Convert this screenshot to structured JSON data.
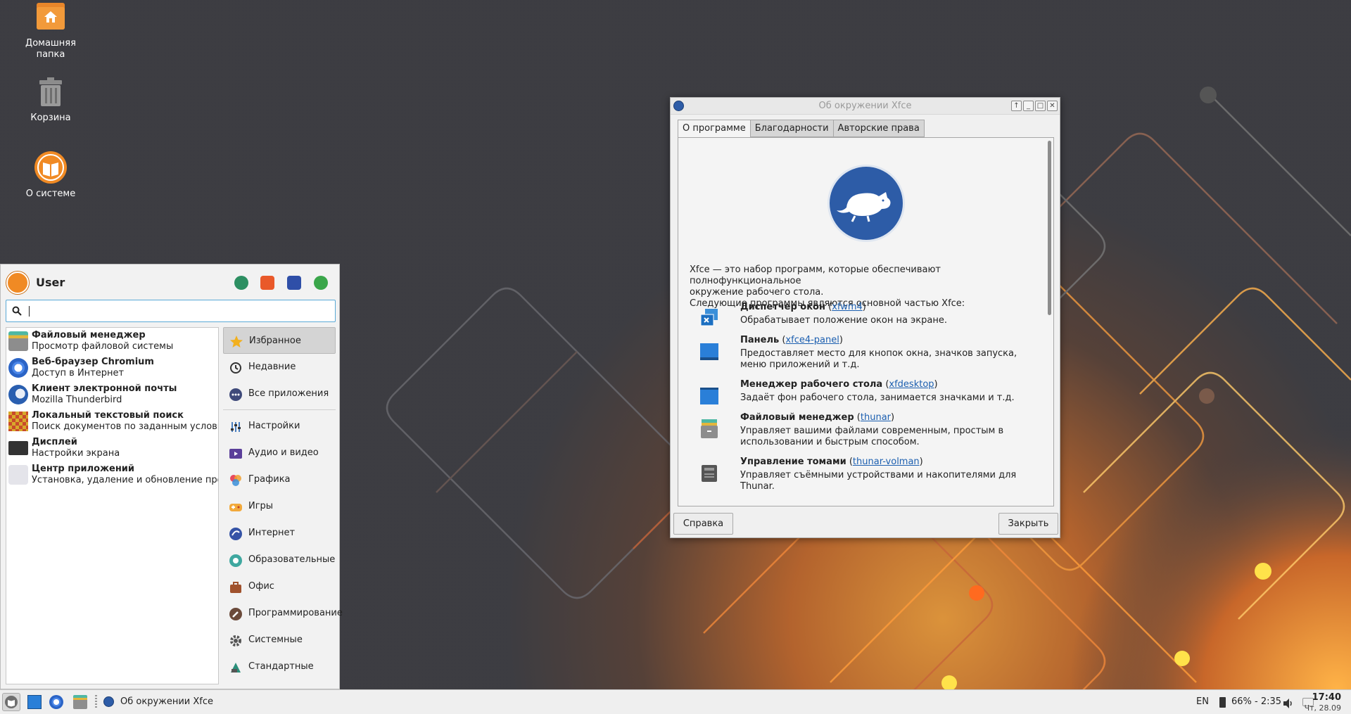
{
  "desktop": {
    "icons": [
      {
        "label_line1": "Домашняя",
        "label_line2": "папка",
        "icon": "home-folder-icon"
      },
      {
        "label": "Корзина",
        "icon": "trash-icon"
      },
      {
        "label": "О системе",
        "icon": "about-system-icon"
      }
    ]
  },
  "menu": {
    "user": "User",
    "actions": [
      "settings-icon",
      "lock-icon",
      "switch-user-icon",
      "logout-icon"
    ],
    "search": {
      "value": "",
      "placeholder": ""
    },
    "apps": [
      {
        "name": "Файловый менеджер",
        "desc": "Просмотр файловой системы",
        "icon": "file-manager-icon"
      },
      {
        "name": "Веб-браузер Chromium",
        "desc": "Доступ в Интернет",
        "icon": "chromium-icon"
      },
      {
        "name": "Клиент электронной почты",
        "desc": "Mozilla Thunderbird",
        "icon": "thunderbird-icon"
      },
      {
        "name": "Локальный текстовый поиск",
        "desc": "Поиск документов по заданным условиям",
        "icon": "text-search-icon"
      },
      {
        "name": "Дисплей",
        "desc": "Настройки экрана",
        "icon": "display-icon"
      },
      {
        "name": "Центр приложений",
        "desc": "Установка, удаление и обновление прогр…",
        "icon": "app-center-icon"
      }
    ],
    "categories": [
      {
        "label": "Избранное",
        "icon": "star-icon",
        "active": true
      },
      {
        "label": "Недавние",
        "icon": "clock-icon"
      },
      {
        "label": "Все приложения",
        "icon": "all-apps-icon"
      },
      {
        "label": "Настройки",
        "icon": "settings-icon"
      },
      {
        "label": "Аудио и видео",
        "icon": "multimedia-icon"
      },
      {
        "label": "Графика",
        "icon": "graphics-icon"
      },
      {
        "label": "Игры",
        "icon": "games-icon"
      },
      {
        "label": "Интернет",
        "icon": "internet-icon"
      },
      {
        "label": "Образовательные",
        "icon": "education-icon"
      },
      {
        "label": "Офис",
        "icon": "office-icon"
      },
      {
        "label": "Программирование",
        "icon": "development-icon"
      },
      {
        "label": "Системные",
        "icon": "system-icon"
      },
      {
        "label": "Стандартные",
        "icon": "accessories-icon"
      }
    ]
  },
  "dialog": {
    "title": "Об окружении Xfce",
    "tabs": [
      "О программе",
      "Благодарности",
      "Авторские права"
    ],
    "intro_line1": "Xfce — это набор программ, которые обеспечивают полнофункциональное",
    "intro_line2": "окружение рабочего стола.",
    "intro_line3": "Следующие программы являются основной частью Xfce:",
    "components": [
      {
        "name": "Диспетчер окон",
        "pkg": "xfwm4",
        "desc": "Обрабатывает положение окон на экране.",
        "icon": "window-manager-icon"
      },
      {
        "name": "Панель",
        "pkg": "xfce4-panel",
        "desc": "Предоставляет место для кнопок окна, значков запуска, меню приложений и т.д.",
        "icon": "panel-icon"
      },
      {
        "name": "Менеджер рабочего стола",
        "pkg": "xfdesktop",
        "desc": "Задаёт фон рабочего стола, занимается значками и т.д.",
        "icon": "desktop-manager-icon"
      },
      {
        "name": "Файловый менеджер",
        "pkg": "thunar",
        "desc": "Управляет вашими файлами современным, простым в использовании и быстрым способом.",
        "icon": "file-manager-icon"
      },
      {
        "name": "Управление томами",
        "pkg": "thunar-volman",
        "desc": "Управляет съёмными устройствами и накопителями для Thunar.",
        "icon": "volume-manager-icon"
      }
    ],
    "help_button": "Справка",
    "close_button": "Закрыть"
  },
  "taskbar": {
    "active_task": "Об окружении Xfce",
    "keyboard_layout": "EN",
    "battery": "66% - 2:35",
    "time": "17:40",
    "date": "Чт, 28.09"
  },
  "colors": {
    "accent": "#f08a24",
    "xfce_blue": "#2d5ca7",
    "link": "#1c5fb0"
  }
}
